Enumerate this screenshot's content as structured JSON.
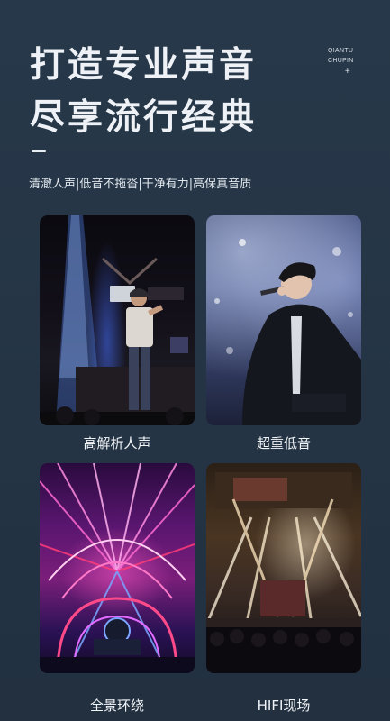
{
  "header": {
    "title_line1": "打造专业声音",
    "title_line2": "尽享流行经典",
    "brand_line1": "QIANTU",
    "brand_line2": "CHUPIN",
    "brand_mark": "+"
  },
  "tagline": "清澈人声|低音不拖沓|干净有力|高保真音质",
  "features": [
    {
      "label": "高解析人声",
      "icon": "photo-rapper-on-stage"
    },
    {
      "label": "超重低音",
      "icon": "photo-singer-with-microphone"
    },
    {
      "label": "全景环绕",
      "icon": "photo-concert-arena-lights"
    },
    {
      "label": "HIFI现场",
      "icon": "photo-live-concert-stage"
    }
  ],
  "colors": {
    "background": "#25364a",
    "text": "#eef2f6"
  }
}
